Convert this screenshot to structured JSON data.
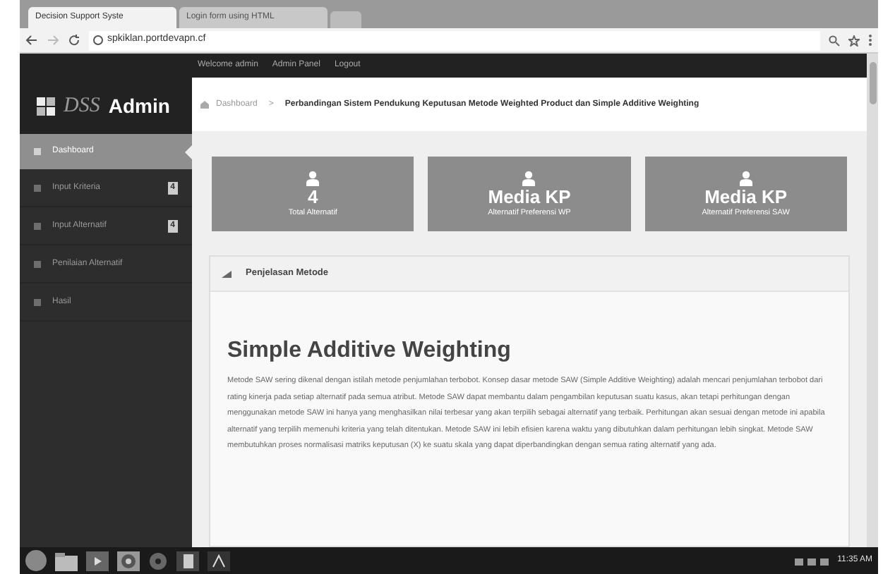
{
  "browser": {
    "tabs": [
      {
        "title": "Decision Support Syste",
        "selected": true
      },
      {
        "title": "Login form using HTML",
        "selected": false
      }
    ],
    "address": "spkiklan.portdevapn.cf"
  },
  "topnav": [
    "Welcome admin",
    "Admin Panel",
    "Logout"
  ],
  "brand": {
    "logo": "DSS",
    "title": "Admin"
  },
  "sidebar": {
    "items": [
      {
        "label": "Dashboard",
        "selected": true
      },
      {
        "label": "Input Kriteria",
        "badge": "4",
        "selected": false
      },
      {
        "label": "Input Alternatif",
        "badge": "4",
        "selected": false
      },
      {
        "label": "Penilaian Alternatif",
        "selected": false
      },
      {
        "label": "Hasil",
        "selected": false
      }
    ]
  },
  "breadcrumb": {
    "home": "Dashboard",
    "separator": ">",
    "current": "Perbandingan Sistem Pendukung Keputusan Metode Weighted Product dan Simple Additive Weighting"
  },
  "cards": [
    {
      "value": "4",
      "label": "Total Alternatif"
    },
    {
      "value": "Media KP",
      "label": "Alternatif Preferensi WP"
    },
    {
      "value": "Media KP",
      "label": "Alternatif Preferensi SAW"
    }
  ],
  "panel": {
    "title": "Penjelasan Metode",
    "heading": "Simple Additive Weighting",
    "body": "Metode SAW sering dikenal dengan istilah metode penjumlahan terbobot. Konsep dasar metode SAW (Simple Additive Weighting) adalah mencari penjumlahan terbobot dari rating kinerja pada setiap alternatif pada semua atribut. Metode SAW dapat membantu dalam pengambilan keputusan suatu kasus, akan tetapi perhitungan dengan menggunakan metode SAW ini hanya yang menghasilkan nilai terbesar yang akan terpilih sebagai alternatif yang terbaik. Perhitungan akan sesuai dengan metode ini apabila alternatif yang terpilih memenuhi kriteria yang telah ditentukan. Metode SAW ini lebih efisien karena waktu yang dibutuhkan dalam perhitungan lebih singkat. Metode SAW membutuhkan proses normalisasi matriks keputusan (X) ke suatu skala yang dapat diperbandingkan dengan semua rating alternatif yang ada."
  },
  "taskbar": {
    "clock": "11:35 AM"
  }
}
